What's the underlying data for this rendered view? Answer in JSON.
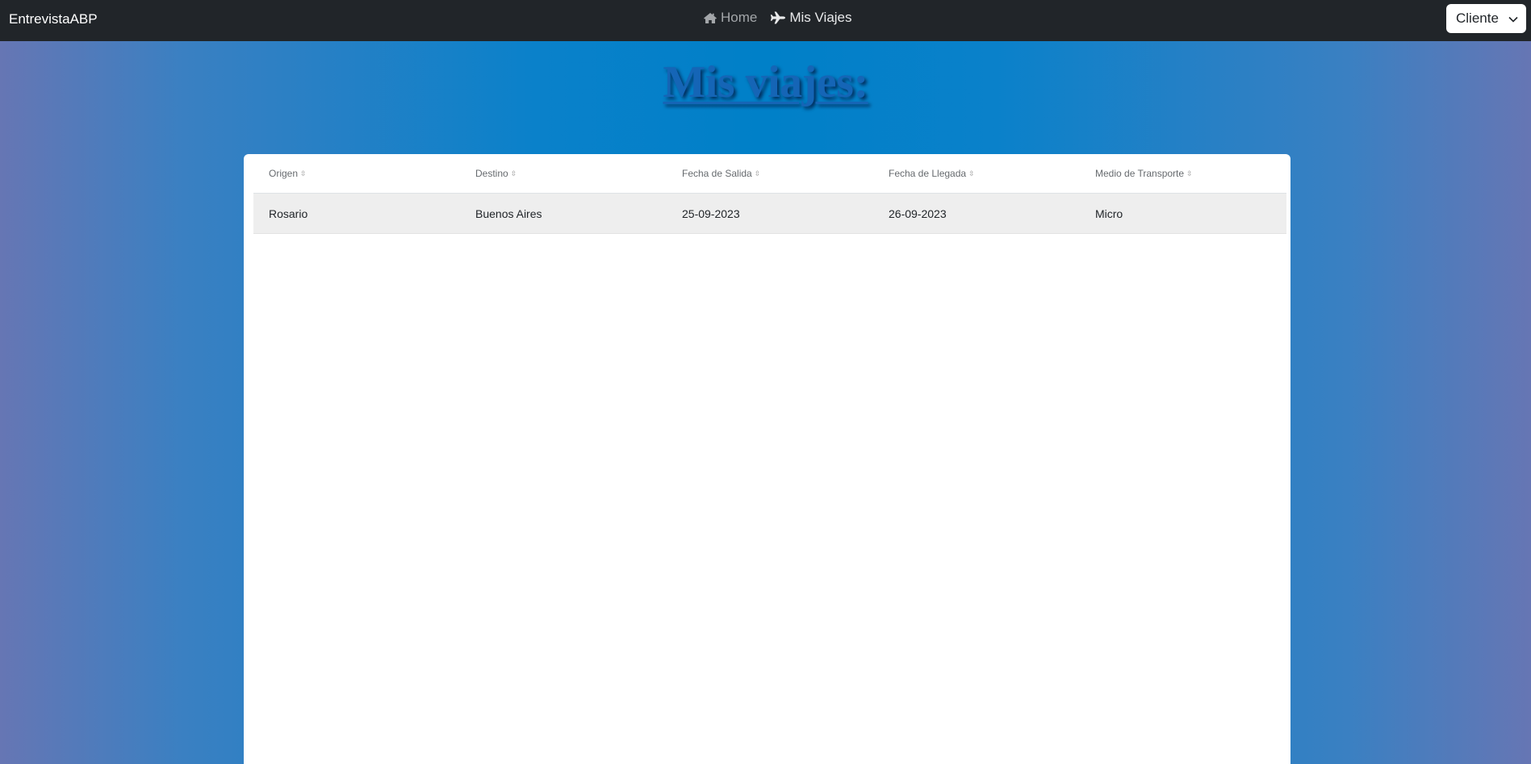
{
  "navbar": {
    "brand": "EntrevistaABP",
    "links": [
      {
        "label": "Home",
        "icon": "home-icon"
      },
      {
        "label": "Mis Viajes",
        "icon": "plane-icon"
      }
    ],
    "user_menu": {
      "label": "Cliente",
      "icon": "chevron-down-icon"
    }
  },
  "page": {
    "title": "Mis viajes:"
  },
  "table": {
    "columns": [
      "Origen",
      "Destino",
      "Fecha de Salida",
      "Fecha de Llegada",
      "Medio de Transporte"
    ],
    "rows": [
      [
        "Rosario",
        "Buenos Aires",
        "25-09-2023",
        "26-09-2023",
        "Micro"
      ]
    ]
  },
  "colors": {
    "navbar_bg": "#212529",
    "title": "#1565b6",
    "background_center": "#0080c8",
    "background_edge": "#6676b4",
    "row_bg": "#eeeeee"
  }
}
